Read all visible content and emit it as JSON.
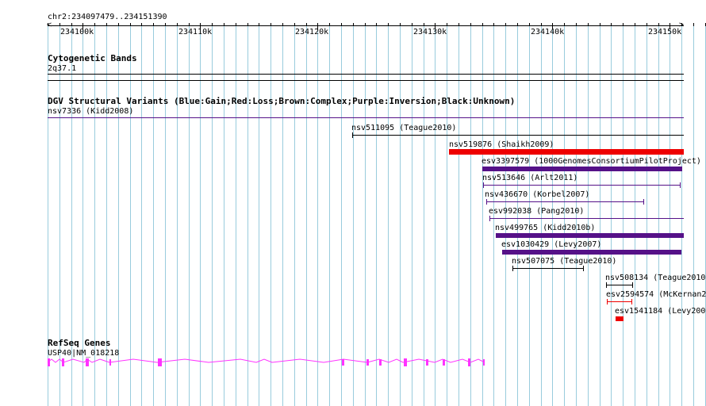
{
  "location": "chr2:234097479..234151390",
  "ruler": {
    "start": 234097479,
    "end": 234151390,
    "ticks": [
      "234100k",
      "234110k",
      "234120k",
      "234130k",
      "234140k",
      "234150k"
    ]
  },
  "tracks": {
    "cyto": {
      "title": "Cytogenetic Bands",
      "label": "2q37.1"
    },
    "dgv": {
      "title": "DGV Structural Variants (Blue:Gain;Red:Loss;Brown:Complex;Purple:Inversion;Black:Unknown)",
      "features": [
        {
          "label": "nsv7336 (Kidd2008)"
        },
        {
          "label": "nsv511095 (Teague2010)"
        },
        {
          "label": "nsv519876 (Shaikh2009)"
        },
        {
          "label": "esv3397579 (1000GenomesConsortiumPilotProject)"
        },
        {
          "label": "nsv513646 (Arlt2011)"
        },
        {
          "label": "nsv436670 (Korbel2007)"
        },
        {
          "label": "esv992038 (Pang2010)"
        },
        {
          "label": "nsv499765 (Kidd2010b)"
        },
        {
          "label": "esv1030429 (Levy2007)"
        },
        {
          "label": "nsv507075 (Teague2010)"
        },
        {
          "label": "nsv508134 (Teague2010"
        },
        {
          "label": "esv2594574 (McKernan2"
        },
        {
          "label": "esv1541184 (Levy200"
        }
      ]
    },
    "refseq": {
      "title": "RefSeq Genes",
      "gene_label": "USP40|NM_018218"
    }
  },
  "colors": {
    "grid": "#99ccdd",
    "gain": "#0000ff",
    "loss": "#ee0000",
    "inversion": "#551188",
    "unknown": "#000000",
    "gene": "#ff33ff"
  }
}
